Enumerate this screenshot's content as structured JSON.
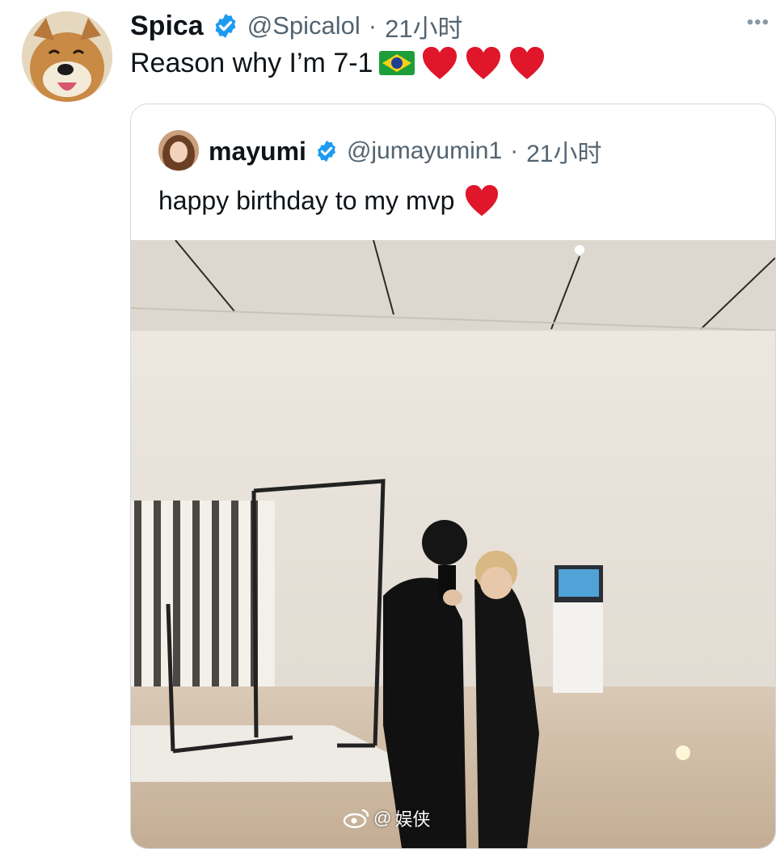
{
  "tweet": {
    "author_name": "Spica",
    "handle": "@Spicalol",
    "separator": "·",
    "time": "21小时",
    "text": "Reason why I’m 7-1",
    "emoji": [
      "brazil-flag",
      "red-heart",
      "red-heart",
      "red-heart"
    ],
    "more_label": "•••"
  },
  "quoted_tweet": {
    "author_name": "mayumi",
    "handle": "@jumayumin1",
    "separator": "·",
    "time": "21小时",
    "text": "happy birthday to my mvp",
    "emoji": [
      "red-heart"
    ]
  },
  "watermark": {
    "symbol": "@",
    "text": "娱侠"
  },
  "colors": {
    "verified": "#1d9bf0",
    "heart": "#e0162b",
    "text": "#0f1419",
    "muted": "#536471",
    "border": "#cfd9de"
  }
}
